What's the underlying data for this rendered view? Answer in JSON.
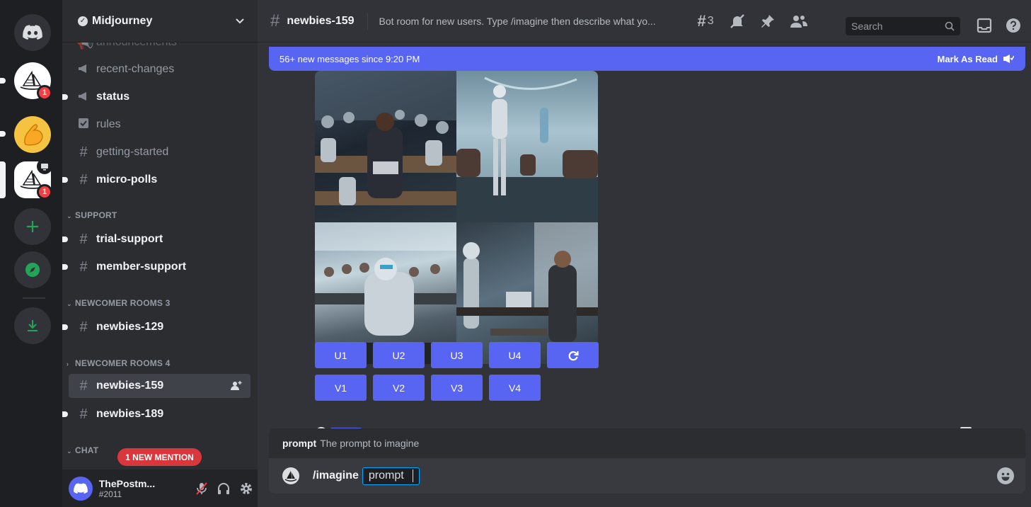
{
  "colors": {
    "blurple": "#5865f2",
    "mention_red": "#da373c",
    "badge_red": "#f23f43",
    "selected_channel": "#404249",
    "add_server_green": "#23a559"
  },
  "rail": {
    "servers": [
      {
        "icon": "discord-home-icon"
      },
      {
        "icon": "midjourney-sailboat-icon",
        "badge": "1"
      },
      {
        "icon": "flexed-biceps-icon"
      },
      {
        "icon": "midjourney-sailboat-icon",
        "badge": "1",
        "selected": true
      },
      {
        "icon": "plus-icon"
      },
      {
        "icon": "compass-icon"
      },
      {
        "icon": "download-icon"
      }
    ]
  },
  "sidebar": {
    "guild_name": "Midjourney",
    "channels_top": [
      {
        "label": "announcements",
        "icon": "megaphone-icon"
      },
      {
        "label": "recent-changes",
        "icon": "megaphone-icon"
      },
      {
        "label": "status",
        "icon": "megaphone-icon",
        "unread": true
      },
      {
        "label": "rules",
        "icon": "checkbox-icon"
      },
      {
        "label": "getting-started",
        "icon": "hash-icon"
      },
      {
        "label": "micro-polls",
        "icon": "locked-hash-icon",
        "unread": true
      }
    ],
    "categories": [
      {
        "label": "SUPPORT",
        "collapsed": false
      },
      {
        "label": "NEWCOMER ROOMS 3",
        "collapsed": false
      },
      {
        "label": "NEWCOMER ROOMS 4",
        "collapsed": true
      },
      {
        "label": "CHAT",
        "collapsed": false
      }
    ],
    "support_channels": [
      {
        "label": "trial-support",
        "unread": true
      },
      {
        "label": "member-support",
        "unread": true
      }
    ],
    "rooms3_channels": [
      {
        "label": "newbies-129",
        "unread": true
      }
    ],
    "rooms4_channels": [
      {
        "label": "newbies-159",
        "selected": true
      },
      {
        "label": "newbies-189",
        "unread": true
      }
    ],
    "mention_pill": "1 NEW MENTION"
  },
  "user_panel": {
    "username": "ThePostm...",
    "tag": "#2011"
  },
  "header": {
    "channel_name": "newbies-159",
    "topic": "Bot room for new users. Type /imagine then describe what yo...",
    "thread_count": "3",
    "search_placeholder": "Search"
  },
  "new_messages_bar": {
    "text": "56+ new messages since 9:20 PM",
    "action": "Mark As Read"
  },
  "image_grid": {
    "description_tiles": 4
  },
  "buttons": {
    "upscale": [
      "U1",
      "U2",
      "U3",
      "U4"
    ],
    "variation": [
      "V1",
      "V2",
      "V3",
      "V4"
    ]
  },
  "autocomplete": {
    "option_name": "prompt",
    "option_desc": "The prompt to imagine"
  },
  "composer": {
    "command": "/imagine",
    "option_chip": "prompt"
  }
}
